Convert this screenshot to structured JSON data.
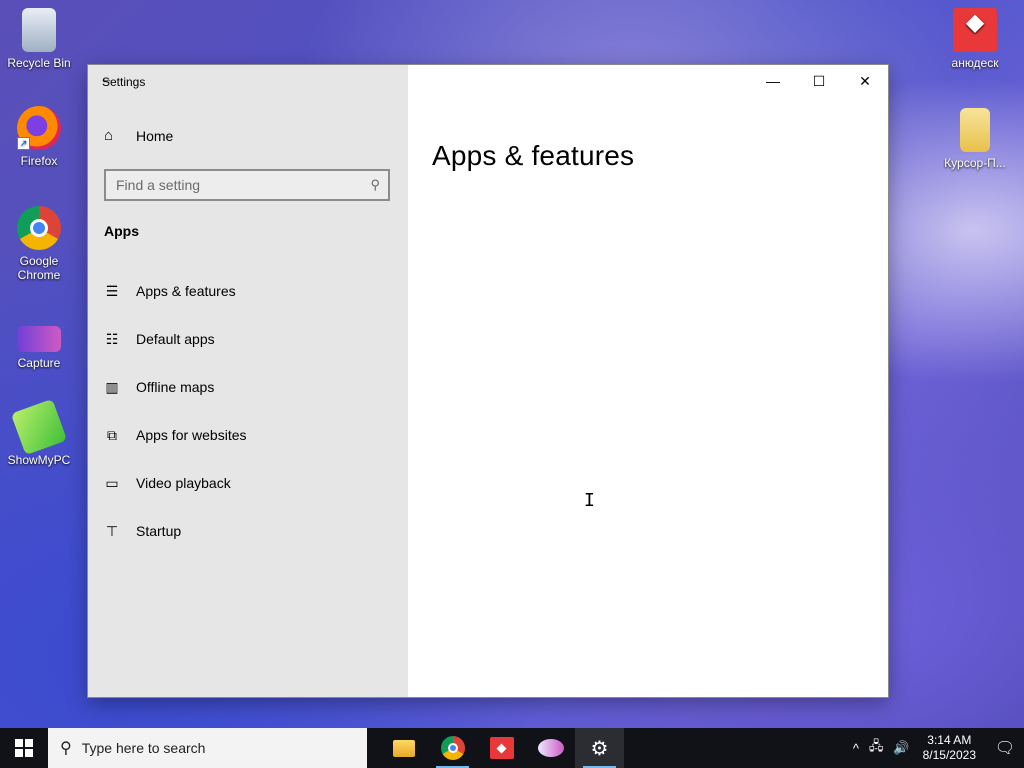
{
  "desktop": {
    "icons": [
      {
        "label": "Recycle Bin"
      },
      {
        "label": "Firefox"
      },
      {
        "label": "Google Chrome"
      },
      {
        "label": "Capture"
      },
      {
        "label": "ShowMyPC"
      },
      {
        "label": "анюдеск"
      },
      {
        "label": "Курсор-П..."
      }
    ]
  },
  "window": {
    "title": "Settings",
    "controls": {
      "minimize": "—",
      "maximize": "☐",
      "close": "✕"
    }
  },
  "sidebar": {
    "home_label": "Home",
    "search_placeholder": "Find a setting",
    "section_title": "Apps",
    "items": [
      {
        "label": "Apps & features"
      },
      {
        "label": "Default apps"
      },
      {
        "label": "Offline maps"
      },
      {
        "label": "Apps for websites"
      },
      {
        "label": "Video playback"
      },
      {
        "label": "Startup"
      }
    ]
  },
  "content": {
    "page_title": "Apps & features"
  },
  "taskbar": {
    "search_placeholder": "Type here to search",
    "time": "3:14 AM",
    "date": "8/15/2023"
  }
}
